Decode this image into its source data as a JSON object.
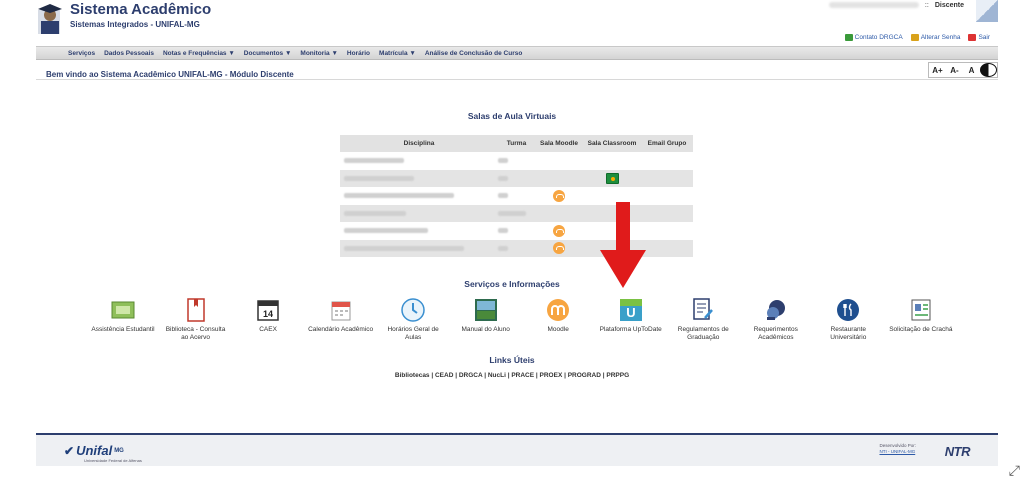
{
  "header": {
    "title": "Sistema Acadêmico",
    "subtitle": "Sistemas Integrados - UNIFAL-MG",
    "separator": "::",
    "user_role": "Discente",
    "links": [
      {
        "label": "Contato DRGCA",
        "icon": "contact-icon",
        "color": "#3a9a3a"
      },
      {
        "label": "Alterar Senha",
        "icon": "lock-icon",
        "color": "#d9a21b"
      },
      {
        "label": "Sair",
        "icon": "exit-icon",
        "color": "#d33"
      }
    ]
  },
  "nav": [
    {
      "label": "Serviços"
    },
    {
      "label": "Dados Pessoais"
    },
    {
      "label": "Notas e Frequências ▼"
    },
    {
      "label": "Documentos ▼"
    },
    {
      "label": "Monitoria ▼"
    },
    {
      "label": "Horário"
    },
    {
      "label": "Matrícula ▼"
    },
    {
      "label": "Análise de Conclusão de Curso"
    }
  ],
  "welcome": "Bem vindo ao Sistema Acadêmico UNIFAL-MG - Módulo Discente",
  "font_tools": {
    "increase": "A+",
    "decrease": "A-",
    "reset": "A"
  },
  "virtual_classes": {
    "title": "Salas de Aula Virtuais",
    "columns": [
      "Disciplina",
      "Turma",
      "Sala Moodle",
      "Sala Classroom",
      "Email Grupo"
    ],
    "rows": [
      {
        "moodle": false,
        "classroom": false
      },
      {
        "moodle": false,
        "classroom": true
      },
      {
        "moodle": true,
        "classroom": false
      },
      {
        "moodle": false,
        "classroom": false
      },
      {
        "moodle": true,
        "classroom": false
      },
      {
        "moodle": true,
        "classroom": false
      }
    ]
  },
  "services": {
    "title": "Serviços e Informações",
    "items": [
      {
        "label": "Assistência Estudantil",
        "icon": "student-assistance-icon"
      },
      {
        "label": "Biblioteca - Consulta ao Acervo",
        "icon": "library-book-icon"
      },
      {
        "label": "CAEX",
        "icon": "calendar-14-icon",
        "icon_text": "14"
      },
      {
        "label": "Calendário Acadêmico",
        "icon": "academic-calendar-icon"
      },
      {
        "label": "Horários Geral de Aulas",
        "icon": "clock-icon"
      },
      {
        "label": "Manual do Aluno",
        "icon": "student-manual-icon"
      },
      {
        "label": "Moodle",
        "icon": "moodle-icon"
      },
      {
        "label": "Plataforma UpToDate",
        "icon": "uptodate-icon",
        "icon_text": "U"
      },
      {
        "label": "Regulamentos de Graduação",
        "icon": "regulations-icon"
      },
      {
        "label": "Requerimentos Acadêmicos",
        "icon": "requests-chat-icon"
      },
      {
        "label": "Restaurante Universitário",
        "icon": "restaurant-icon"
      },
      {
        "label": "Solicitação de Crachá",
        "icon": "badge-request-icon"
      }
    ]
  },
  "links": {
    "title": "Links Úteis",
    "line": "Bibliotecas | CEAD | DRGCA | NucLi | PRACE | PROEX | PROGRAD | PRPPG"
  },
  "footer": {
    "logo_text": "Unifal",
    "logo_suffix": "MG",
    "logo_sub": "Universidade Federal de Alfenas",
    "dev_by": "Desenvolvido Por:",
    "dev_link": "NTI - UNIFAL-MG",
    "ntr": "NTR"
  },
  "colors": {
    "accent": "#2d3e6e",
    "moodle": "#f7a541",
    "arrow": "#e01b1b"
  }
}
